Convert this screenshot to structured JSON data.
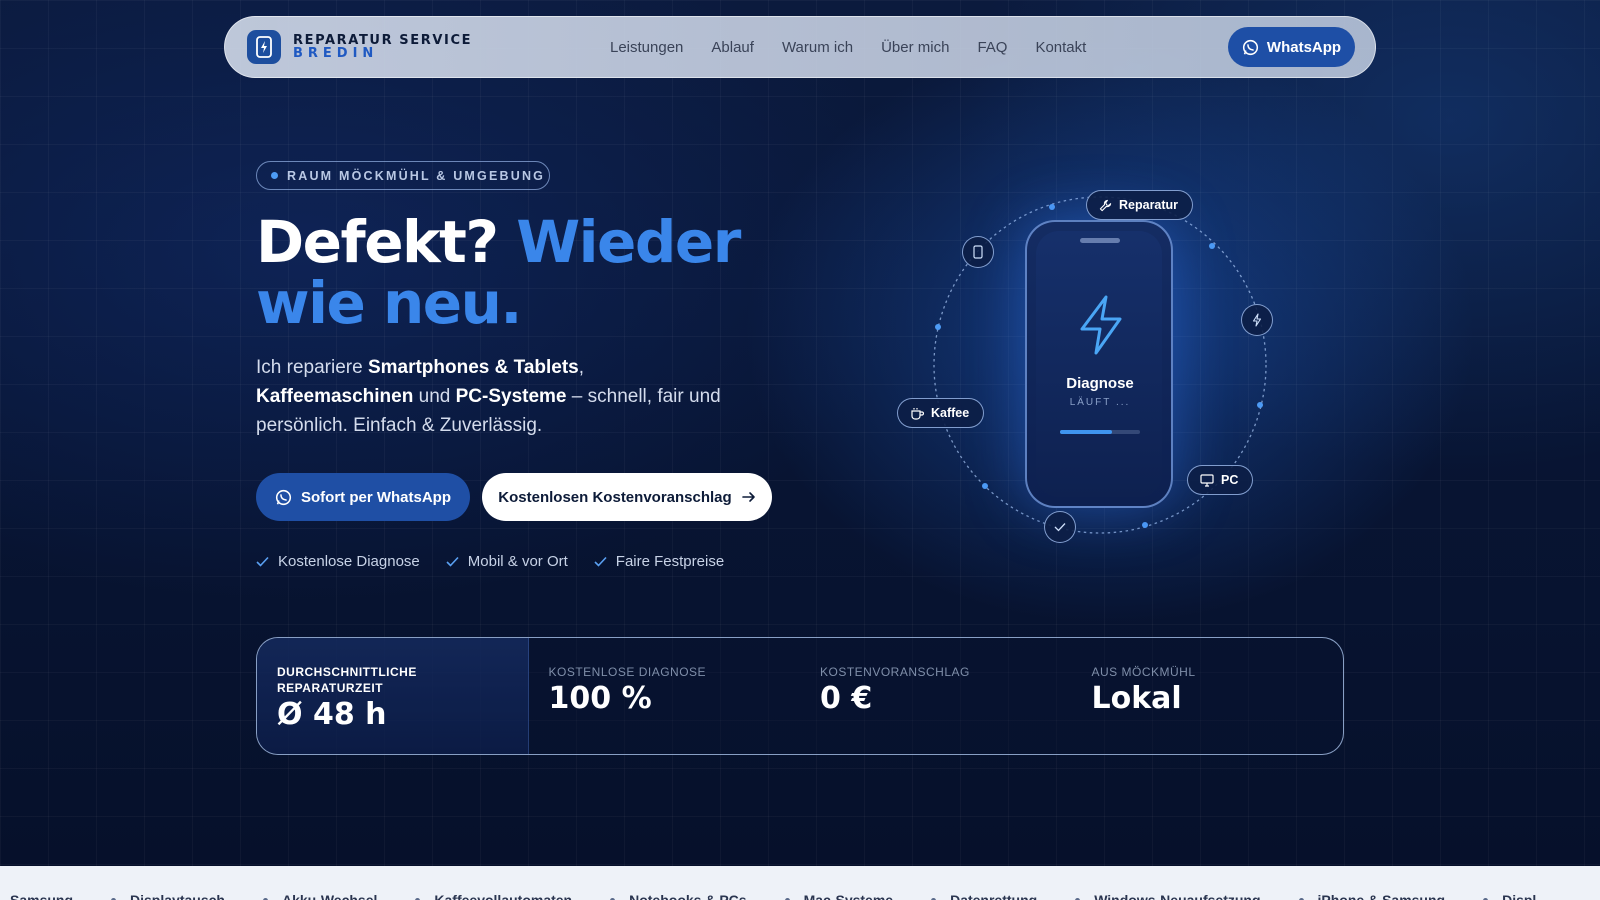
{
  "brand": {
    "line1": "REPARATUR SERVICE",
    "line2": "BREDIN"
  },
  "nav": {
    "links": [
      "Leistungen",
      "Ablauf",
      "Warum ich",
      "Über mich",
      "FAQ",
      "Kontakt"
    ],
    "whatsapp_label": "WhatsApp"
  },
  "hero": {
    "pill": "RAUM MÖCKMÜHL & UMGEBUNG",
    "headline_white": "Defekt?",
    "headline_blue_1": "Wieder",
    "headline_blue_2": "wie neu.",
    "lead": {
      "p1": "Ich repariere ",
      "b1": "Smartphones & Tablets",
      "p2": ", ",
      "b2": "Kaffeemaschinen",
      "p3": " und ",
      "b3": "PC-Systeme",
      "p4": " – schnell, fair und persönlich. Einfach & Zuverlässig."
    },
    "btn_whatsapp": "Sofort per WhatsApp",
    "btn_quote": "Kostenlosen Kostenvoranschlag",
    "checks": [
      "Kostenlose Diagnose",
      "Mobil & vor Ort",
      "Faire Festpreise"
    ]
  },
  "illustration": {
    "chips": {
      "repair": "Reparatur",
      "coffee": "Kaffee",
      "pc": "PC"
    },
    "phone_title": "Diagnose",
    "phone_status": "LÄUFT ...",
    "progress": 0.65,
    "accent": "#3f95f0"
  },
  "stats": [
    {
      "label": "DURCHSCHNITTLICHE REPARATURZEIT",
      "value": "Ø 48 h"
    },
    {
      "label": "KOSTENLOSE DIAGNOSE",
      "value": "100 %"
    },
    {
      "label": "KOSTENVORANSCHLAG",
      "value": "0 €"
    },
    {
      "label": "AUS MÖCKMÜHL",
      "value": "Lokal"
    }
  ],
  "marquee": [
    "Samsung",
    "Displaytausch",
    "Akku-Wechsel",
    "Kaffeevollautomaten",
    "Notebooks & PCs",
    "Mac-Systeme",
    "Datenrettung",
    "Windows-Neuaufsetzung",
    "iPhone & Samsung",
    "Displ"
  ],
  "colors": {
    "primary": "#1f4fa5",
    "accent": "#3a86ea",
    "bg": "#081534"
  }
}
